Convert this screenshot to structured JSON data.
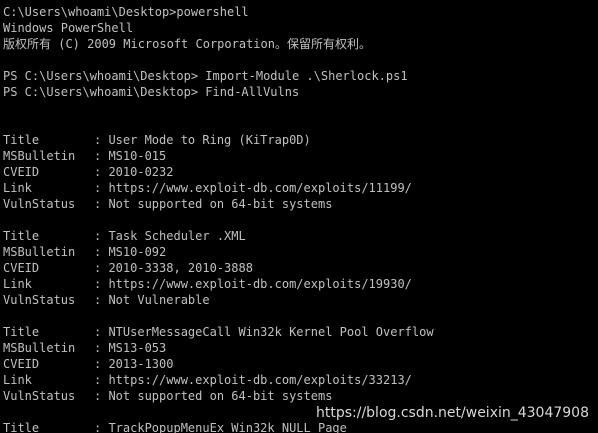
{
  "console": {
    "header_lines": [
      "C:\\Users\\whoami\\Desktop>powershell",
      "Windows PowerShell",
      "版权所有 (C) 2009 Microsoft Corporation。保留所有权利。"
    ],
    "command_lines": [
      "PS C:\\Users\\whoami\\Desktop> Import-Module .\\Sherlock.ps1",
      "PS C:\\Users\\whoami\\Desktop> Find-AllVulns"
    ],
    "field_labels": {
      "title": "Title",
      "msbulletin": "MSBulletin",
      "cveid": "CVEID",
      "link": "Link",
      "vulnstatus": "VulnStatus",
      "separator": ": "
    },
    "vulns": [
      {
        "title": "User Mode to Ring (KiTrap0D)",
        "msbulletin": "MS10-015",
        "cveid": "2010-0232",
        "link": "https://www.exploit-db.com/exploits/11199/",
        "vulnstatus": "Not supported on 64-bit systems"
      },
      {
        "title": "Task Scheduler .XML",
        "msbulletin": "MS10-092",
        "cveid": "2010-3338, 2010-3888",
        "link": "https://www.exploit-db.com/exploits/19930/",
        "vulnstatus": "Not Vulnerable"
      },
      {
        "title": "NTUserMessageCall Win32k Kernel Pool Overflow",
        "msbulletin": "MS13-053",
        "cveid": "2013-1300",
        "link": "https://www.exploit-db.com/exploits/33213/",
        "vulnstatus": "Not supported on 64-bit systems"
      },
      {
        "title": "TrackPopupMenuEx Win32k NULL Page"
      }
    ]
  },
  "watermark": "https://blog.csdn.net/weixin_43047908",
  "colors": {
    "background": "#000000",
    "text": "#c0c0c0"
  }
}
